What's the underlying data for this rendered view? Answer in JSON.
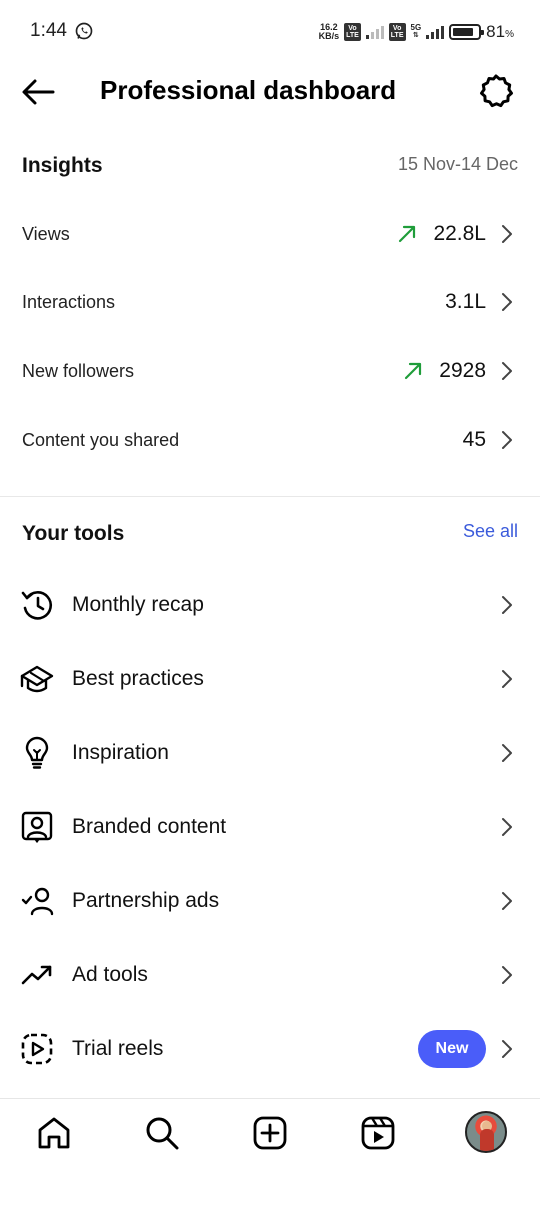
{
  "status_bar": {
    "time": "1:44",
    "net_speed_top": "16.2",
    "net_speed_bottom": "KB/s",
    "volte_top": "Vo",
    "volte_bottom": "LTE",
    "network_5g": "5G",
    "battery": "81",
    "battery_unit": "%",
    "icons": [
      "whatsapp-icon",
      "signal-icon",
      "battery-icon"
    ]
  },
  "header": {
    "title": "Professional dashboard",
    "icons": [
      "back-arrow-icon",
      "settings-gear-icon"
    ]
  },
  "insights": {
    "title": "Insights",
    "date_range": "15 Nov-14 Dec",
    "trend_color": "#1f9d3a",
    "metrics": [
      {
        "label": "Views",
        "value": "22.8L",
        "trend": "up"
      },
      {
        "label": "Interactions",
        "value": "3.1L",
        "trend": "none"
      },
      {
        "label": "New followers",
        "value": "2928",
        "trend": "up"
      },
      {
        "label": "Content you shared",
        "value": "45",
        "trend": "none"
      }
    ]
  },
  "tools": {
    "title": "Your tools",
    "see_all": "See all",
    "accent": "#3b5bdb",
    "items": [
      {
        "label": "Monthly recap",
        "icon": "history-clock-icon"
      },
      {
        "label": "Best practices",
        "icon": "graduation-cap-icon"
      },
      {
        "label": "Inspiration",
        "icon": "lightbulb-icon"
      },
      {
        "label": "Branded content",
        "icon": "branded-content-icon"
      },
      {
        "label": "Partnership ads",
        "icon": "partnership-person-icon"
      },
      {
        "label": "Ad tools",
        "icon": "trending-up-icon"
      },
      {
        "label": "Trial reels",
        "icon": "trial-reels-icon",
        "badge": "New"
      }
    ],
    "badge_color": "#4a5df9"
  },
  "bottom_nav": {
    "items": [
      "home-icon",
      "search-icon",
      "create-icon",
      "reels-icon",
      "profile-avatar"
    ]
  }
}
